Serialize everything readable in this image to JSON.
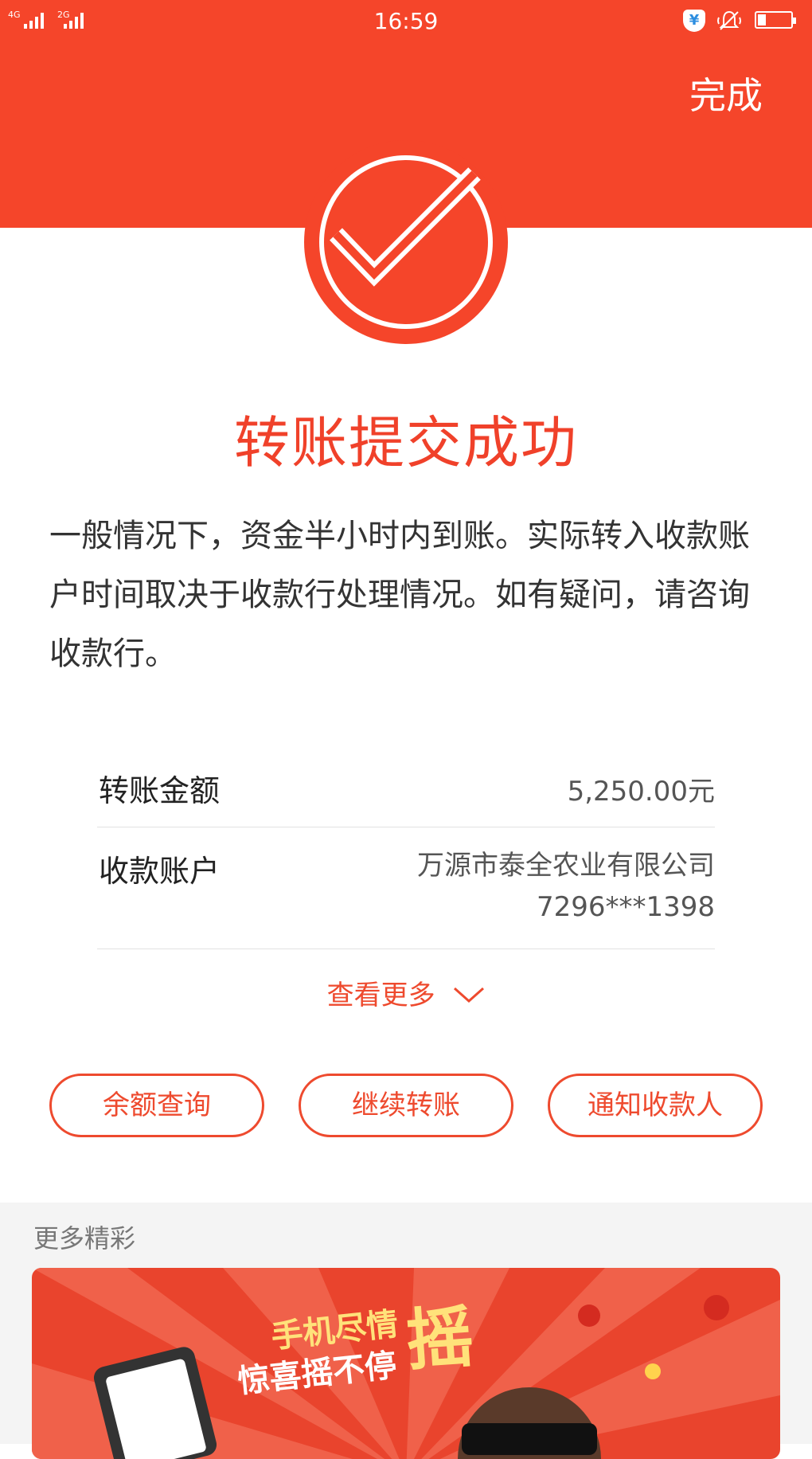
{
  "status_bar": {
    "network_1": "4G",
    "network_2": "2G",
    "time": "16:59",
    "shield_glyph": "¥",
    "battery_level": 0.25
  },
  "header": {
    "done_label": "完成"
  },
  "result": {
    "title": "转账提交成功",
    "description": "一般情况下，资金半小时内到账。实际转入收款账户时间取决于收款行处理情况。如有疑问，请咨询收款行。"
  },
  "details": {
    "amount_label": "转账金额",
    "amount_value": "5,250.00元",
    "account_label": "收款账户",
    "account_name": "万源市泰全农业有限公司",
    "account_number": "7296***1398"
  },
  "view_more": "查看更多",
  "actions": {
    "balance": "余额查询",
    "continue": "继续转账",
    "notify": "通知收款人"
  },
  "more_section": {
    "title": "更多精彩",
    "banner_line1": "手机尽情",
    "banner_line2": "惊喜摇不停",
    "banner_big": "摇"
  },
  "colors": {
    "brand_red": "#f5452a"
  }
}
